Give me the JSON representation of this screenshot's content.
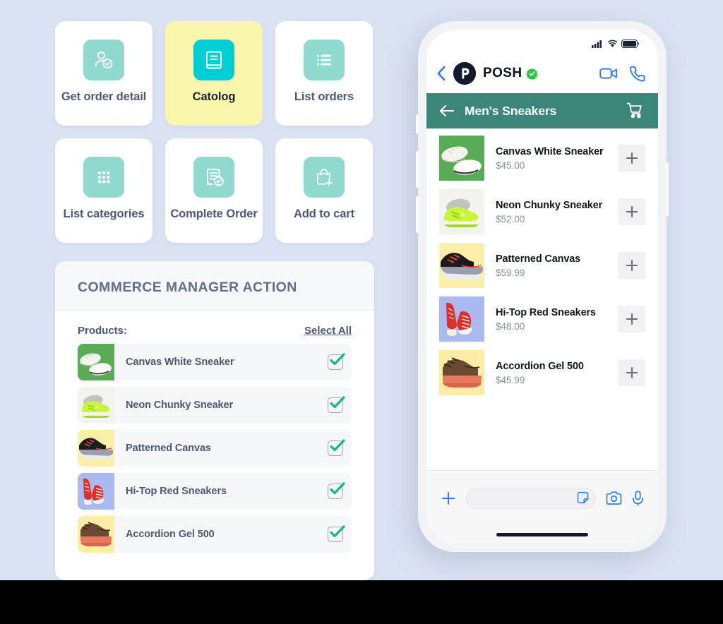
{
  "theme": {
    "canvas_bg": "#dbe2f2",
    "accent_mint": "#8fd9cf",
    "accent_cyan": "#00cdd4",
    "highlight_yellow": "#fbf6ae",
    "teal_bar": "#3c8579",
    "ios_blue": "#2f7bf6",
    "check_green": "#12b886",
    "text_slate": "#4d5875"
  },
  "actions": [
    {
      "label": "Get order detail",
      "icon": "user-check-icon",
      "selected": false
    },
    {
      "label": "Catolog",
      "icon": "book-icon",
      "selected": true
    },
    {
      "label": "List orders",
      "icon": "list-bullet-icon",
      "selected": false
    },
    {
      "label": "List categories",
      "icon": "grid-icon",
      "selected": false
    },
    {
      "label": "Complete Order",
      "icon": "receipt-check-icon",
      "selected": false
    },
    {
      "label": "Add to cart",
      "icon": "bag-plus-icon",
      "selected": false
    }
  ],
  "commerce": {
    "title": "COMMERCE MANAGER ACTION",
    "products_label": "Products:",
    "select_all_label": "Select All",
    "products": [
      {
        "name": "Canvas White Sneaker",
        "checked": true,
        "thumb": "white-sneaker-green-bg"
      },
      {
        "name": "Neon Chunky Sneaker",
        "checked": true,
        "thumb": "neon-sneaker-white-bg"
      },
      {
        "name": "Patterned Canvas",
        "checked": true,
        "thumb": "grey-sneaker-yellow-bg"
      },
      {
        "name": "Hi-Top Red Sneakers",
        "checked": true,
        "thumb": "red-hitop-blue-bg"
      },
      {
        "name": "Accordion Gel 500",
        "checked": true,
        "thumb": "brown-sneaker-yellow-bg"
      }
    ]
  },
  "phone": {
    "statusbar": {
      "signal": "signal-bars-icon",
      "wifi": "wifi-icon",
      "battery": "battery-full-icon"
    },
    "header": {
      "back": "back-chevron-icon",
      "brand": "POSH",
      "logo_letter": "P",
      "verified": "verified-badge-icon",
      "video_call": "video-camera-icon",
      "voice_call": "phone-icon"
    },
    "category_bar": {
      "back_arrow": "arrow-left-icon",
      "title": "Men's Sneakers",
      "cart": "shopping-cart-icon"
    },
    "products": [
      {
        "name": "Canvas White Sneaker",
        "price": "$45.00",
        "thumb": "white-sneaker-green-bg",
        "add": "+"
      },
      {
        "name": "Neon Chunky Sneaker",
        "price": "$52.00",
        "thumb": "neon-sneaker-white-bg",
        "add": "+"
      },
      {
        "name": "Patterned Canvas",
        "price": "$59.99",
        "thumb": "grey-sneaker-yellow-bg",
        "add": "+"
      },
      {
        "name": "Hi-Top Red Sneakers",
        "price": "$48.00",
        "thumb": "red-hitop-blue-bg",
        "add": "+"
      },
      {
        "name": "Accordion Gel 500",
        "price": "$45.99",
        "thumb": "brown-sneaker-yellow-bg",
        "add": "+"
      }
    ],
    "composer": {
      "plus": "plus-icon",
      "input_value": "",
      "input_placeholder": "",
      "sticker": "sticker-icon",
      "camera": "camera-icon",
      "mic": "microphone-icon"
    }
  }
}
